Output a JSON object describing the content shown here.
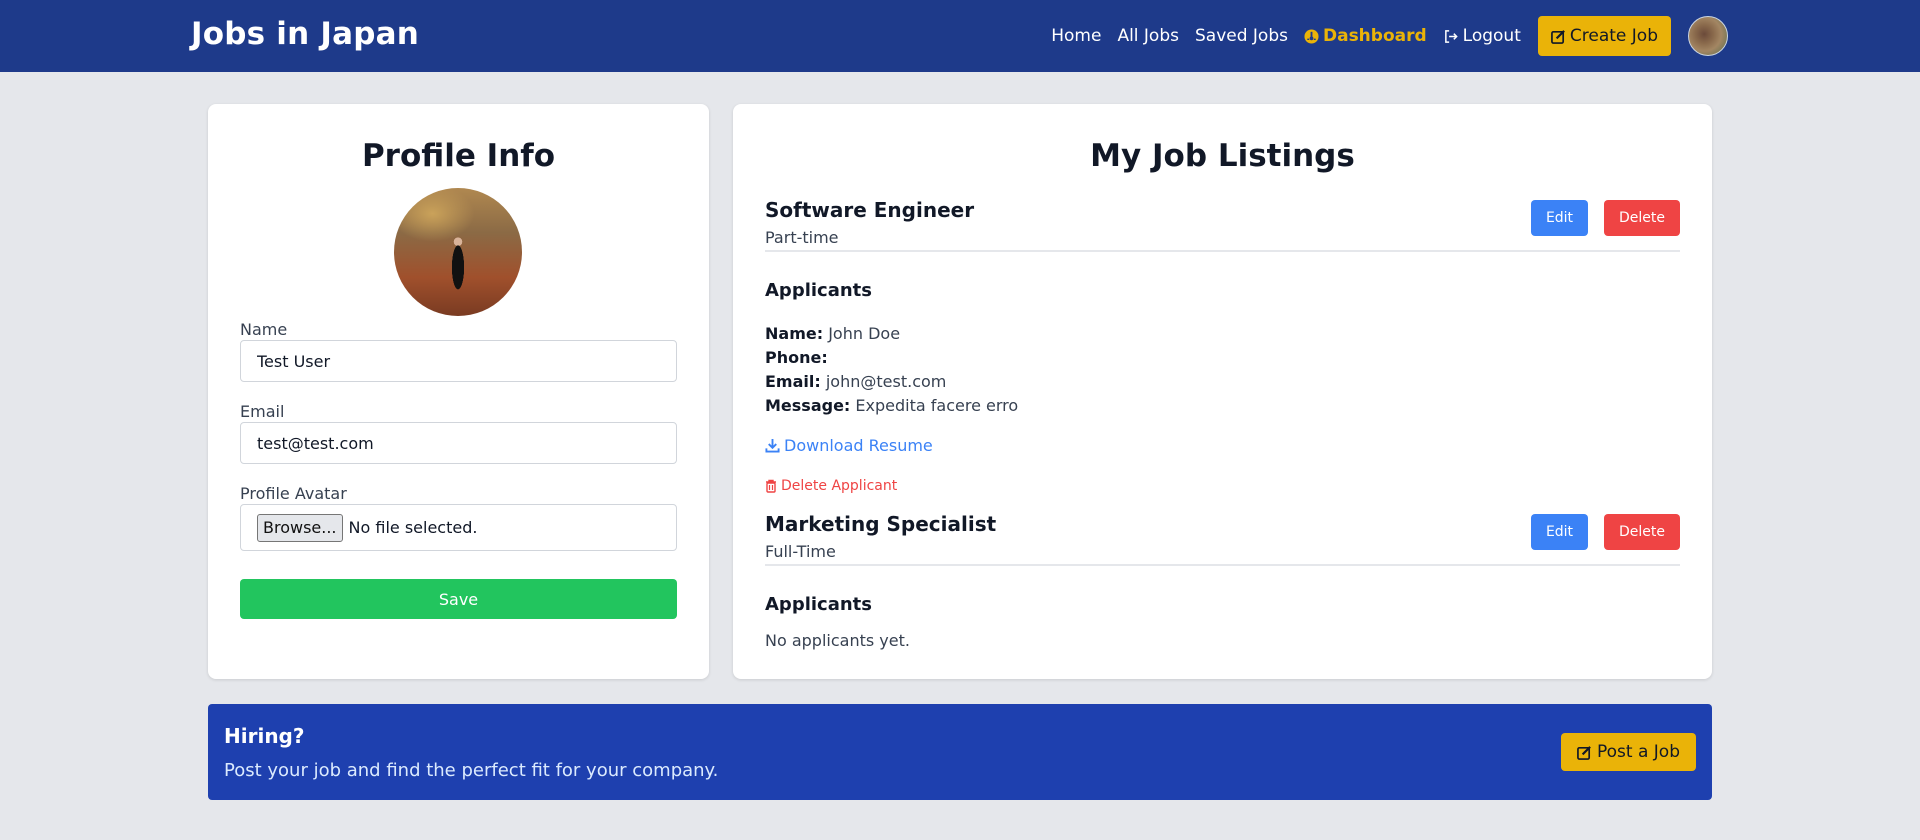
{
  "colors": {
    "header_bg": "#1e3a8a",
    "accent_yellow": "#eab308",
    "save_green": "#22c55e",
    "edit_blue": "#3b82f6",
    "delete_red": "#ef4444",
    "banner_bg": "#1e40af"
  },
  "header": {
    "brand": "Jobs in Japan",
    "nav": {
      "home": "Home",
      "all_jobs": "All Jobs",
      "saved_jobs": "Saved Jobs",
      "dashboard": "Dashboard",
      "logout": "Logout"
    },
    "create_job": "Create Job",
    "icons": {
      "dashboard": "gauge-icon",
      "logout": "logout-icon",
      "create_job": "edit-icon",
      "avatar": "user-avatar"
    }
  },
  "profile": {
    "title": "Profile Info",
    "name_label": "Name",
    "name_value": "Test User",
    "email_label": "Email",
    "email_value": "test@test.com",
    "avatar_label": "Profile Avatar",
    "browse_label": "Browse...",
    "file_status": "No file selected.",
    "save_label": "Save"
  },
  "listings": {
    "title": "My Job Listings",
    "edit_label": "Edit",
    "delete_label": "Delete",
    "applicants_heading": "Applicants",
    "jobs": [
      {
        "title": "Software Engineer",
        "type": "Part-time",
        "applicants": [
          {
            "name_label": "Name:",
            "name": "John Doe",
            "phone_label": "Phone:",
            "phone": "",
            "email_label": "Email:",
            "email": "john@test.com",
            "message_label": "Message:",
            "message": "Expedita facere erro",
            "download_label": "Download Resume",
            "delete_label": "Delete Applicant"
          }
        ]
      },
      {
        "title": "Marketing Specialist",
        "type": "Full-Time",
        "no_applicants": "No applicants yet."
      }
    ]
  },
  "banner": {
    "title": "Hiring?",
    "text": "Post your job and find the perfect fit for your company.",
    "button": "Post a Job"
  }
}
